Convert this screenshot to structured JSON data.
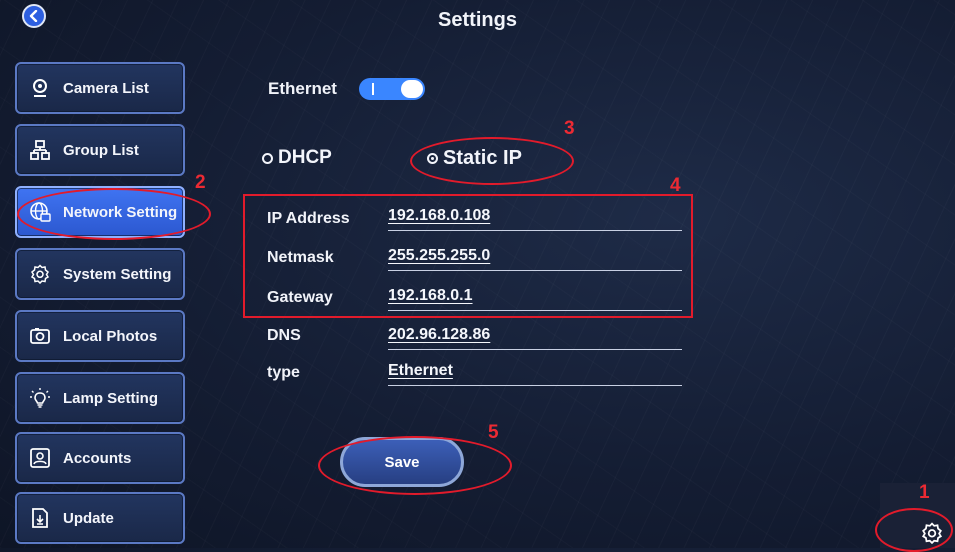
{
  "header": {
    "title": "Settings"
  },
  "sidebar": {
    "items": [
      {
        "label": "Camera List",
        "icon": "camera-icon",
        "active": false
      },
      {
        "label": "Group List",
        "icon": "group-icon",
        "active": false
      },
      {
        "label": "Network Setting",
        "icon": "network-icon",
        "active": true
      },
      {
        "label": "System Setting",
        "icon": "gear-icon",
        "active": false
      },
      {
        "label": "Local Photos",
        "icon": "photo-icon",
        "active": false
      },
      {
        "label": "Lamp Setting",
        "icon": "lamp-icon",
        "active": false
      },
      {
        "label": "Accounts",
        "icon": "account-icon",
        "active": false
      },
      {
        "label": "Update",
        "icon": "update-icon",
        "active": false
      }
    ]
  },
  "network": {
    "ethernet_label": "Ethernet",
    "ethernet_enabled": true,
    "mode_options": [
      {
        "label": "DHCP",
        "selected": false
      },
      {
        "label": "Static IP",
        "selected": true
      }
    ],
    "fields": [
      {
        "label": "IP Address",
        "value": "192.168.0.108"
      },
      {
        "label": "Netmask",
        "value": "255.255.255.0"
      },
      {
        "label": "Gateway",
        "value": "192.168.0.1"
      },
      {
        "label": "DNS",
        "value": "202.96.128.86"
      },
      {
        "label": "type",
        "value": "Ethernet"
      }
    ],
    "save_label": "Save"
  },
  "annotations": [
    "1",
    "2",
    "3",
    "4",
    "5"
  ],
  "colors": {
    "accent": "#3a86ff",
    "active_nav": "#3466e6",
    "annotation": "#e21b2b"
  }
}
